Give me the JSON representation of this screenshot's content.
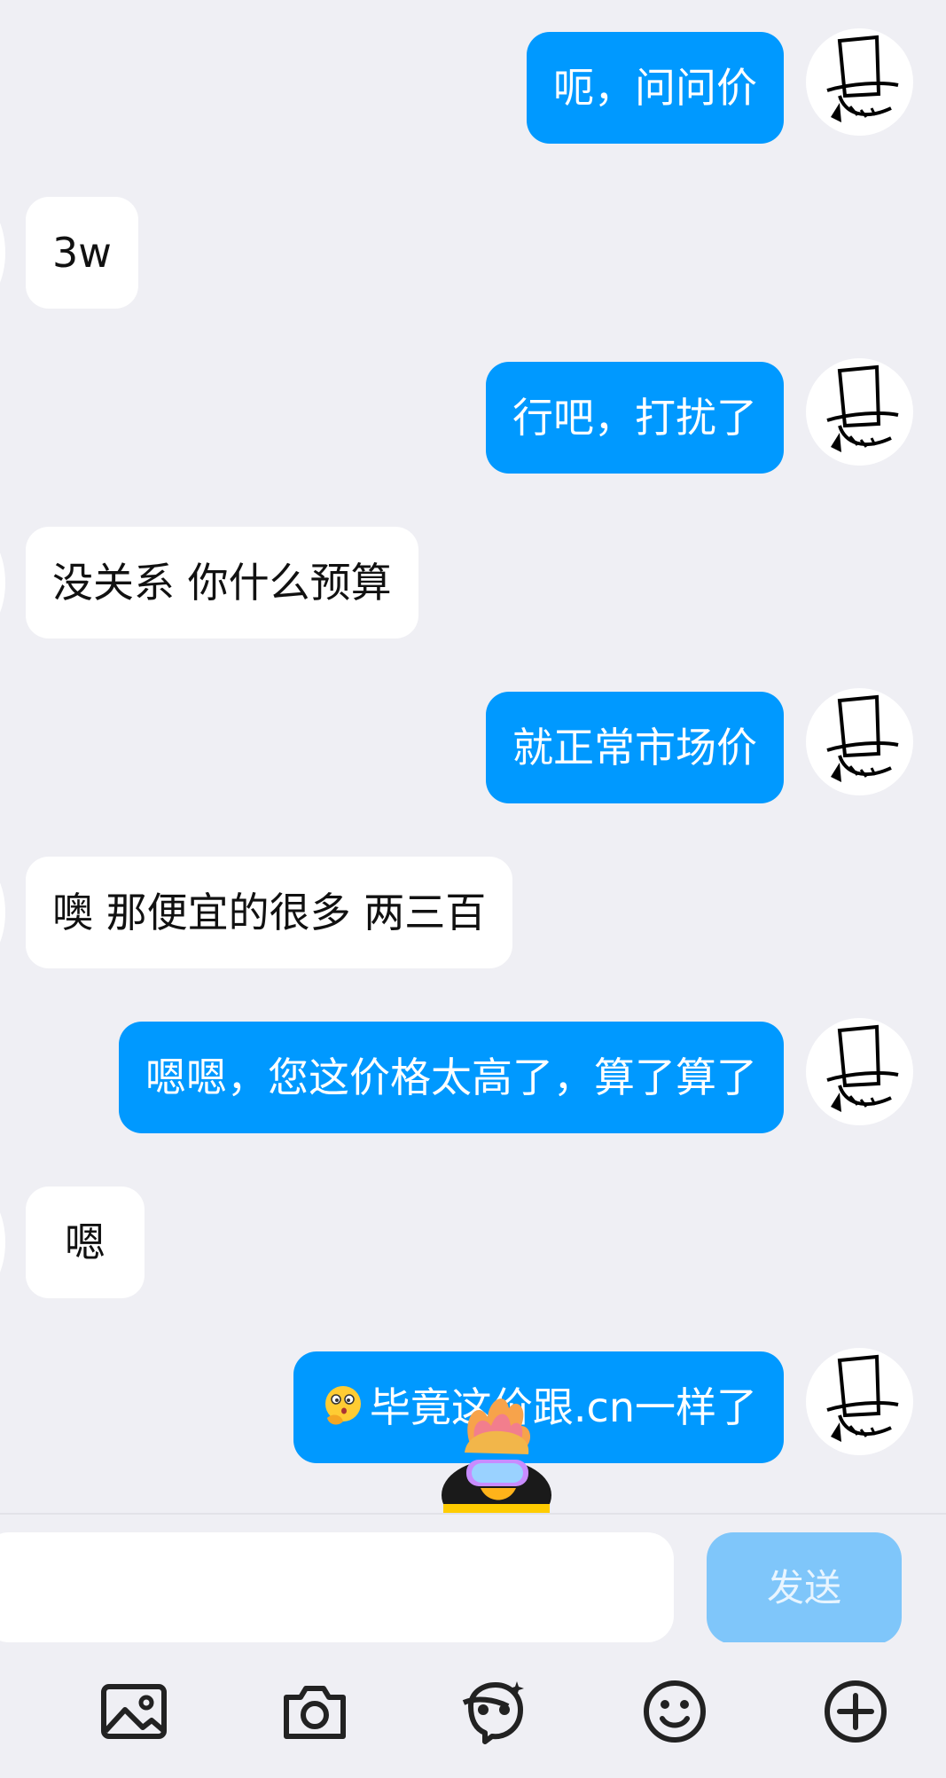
{
  "messages": [
    {
      "side": "out",
      "text": "呃，问问价"
    },
    {
      "side": "in",
      "text": "3w"
    },
    {
      "side": "out",
      "text": "行吧，打扰了"
    },
    {
      "side": "in",
      "text": "没关系 你什么预算"
    },
    {
      "side": "out",
      "text": "就正常市场价"
    },
    {
      "side": "in",
      "text": "噢 那便宜的很多 两三百"
    },
    {
      "side": "out",
      "text": "嗯嗯，您这价格太高了，算了算了"
    },
    {
      "side": "in",
      "text": "嗯"
    },
    {
      "side": "out",
      "emoji": "thinking-face-emoji",
      "text": "毕竟这价跟.cn一样了"
    }
  ],
  "input": {
    "value": "",
    "placeholder": ""
  },
  "send_button": {
    "label": "发送"
  },
  "toolbar": {
    "icons": [
      "image-icon",
      "camera-icon",
      "avatar-sticker-icon",
      "emoji-smile-icon",
      "plus-icon"
    ]
  },
  "colors": {
    "background": "#efeff4",
    "outgoing_bubble": "#0099ff",
    "incoming_bubble": "#ffffff",
    "send_button_disabled": "#7fc6fa"
  }
}
